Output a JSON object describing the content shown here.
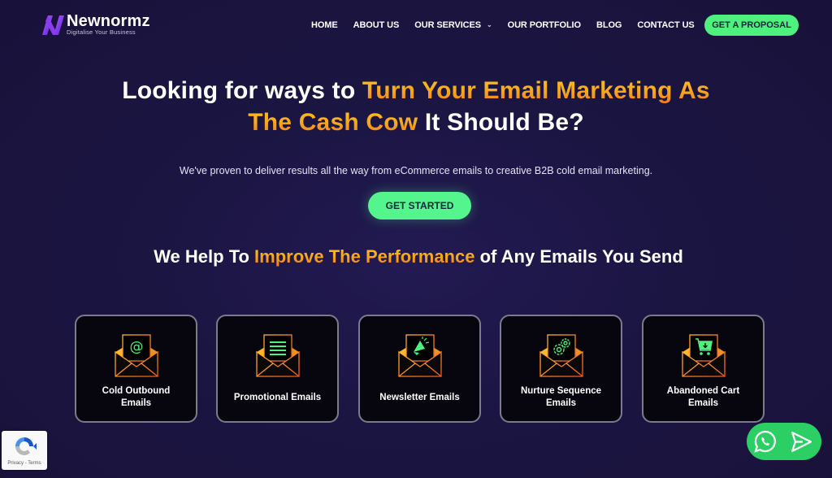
{
  "brand": {
    "name": "Newnormz",
    "tagline": "Digitalise Your Business",
    "logo_icon": "n-logo-icon"
  },
  "nav": {
    "items": [
      {
        "label": "HOME"
      },
      {
        "label": "ABOUT US"
      },
      {
        "label": "OUR SERVICES",
        "dropdown": true
      },
      {
        "label": "OUR PORTFOLIO"
      },
      {
        "label": "BLOG"
      },
      {
        "label": "CONTACT US"
      }
    ],
    "cta_label": "GET A PROPOSAL"
  },
  "hero": {
    "title_part1": "Looking for ways to ",
    "title_highlight1": "Turn Your Email Marketing As",
    "title_highlight2": "The Cash Cow",
    "title_part2": " It Should Be?",
    "subtitle": "We've proven to deliver results all the way from eCommerce emails to creative B2B cold email marketing.",
    "cta_label": "GET STARTED"
  },
  "services": {
    "title_part1": "We Help To ",
    "title_highlight": "Improve The Performance",
    "title_part2": " of Any Emails You Send",
    "cards": [
      {
        "label": "Cold Outbound Emails",
        "icon": "at-sign-envelope-icon"
      },
      {
        "label": "Promotional Emails",
        "icon": "document-lines-envelope-icon"
      },
      {
        "label": "Newsletter Emails",
        "icon": "megaphone-envelope-icon"
      },
      {
        "label": "Nurture Sequence Emails",
        "icon": "gears-envelope-icon"
      },
      {
        "label": "Abandoned Cart Emails",
        "icon": "cart-envelope-icon"
      }
    ]
  },
  "widgets": {
    "recaptcha_text": "Privacy - Terms",
    "chat_icons": [
      "whatsapp-icon",
      "send-icon"
    ]
  },
  "colors": {
    "background": "#1b1542",
    "accent_green": "#4ef07e",
    "accent_orange": "#f7a51d",
    "card_bg": "#07060f",
    "card_border": "#7d7a8c"
  }
}
